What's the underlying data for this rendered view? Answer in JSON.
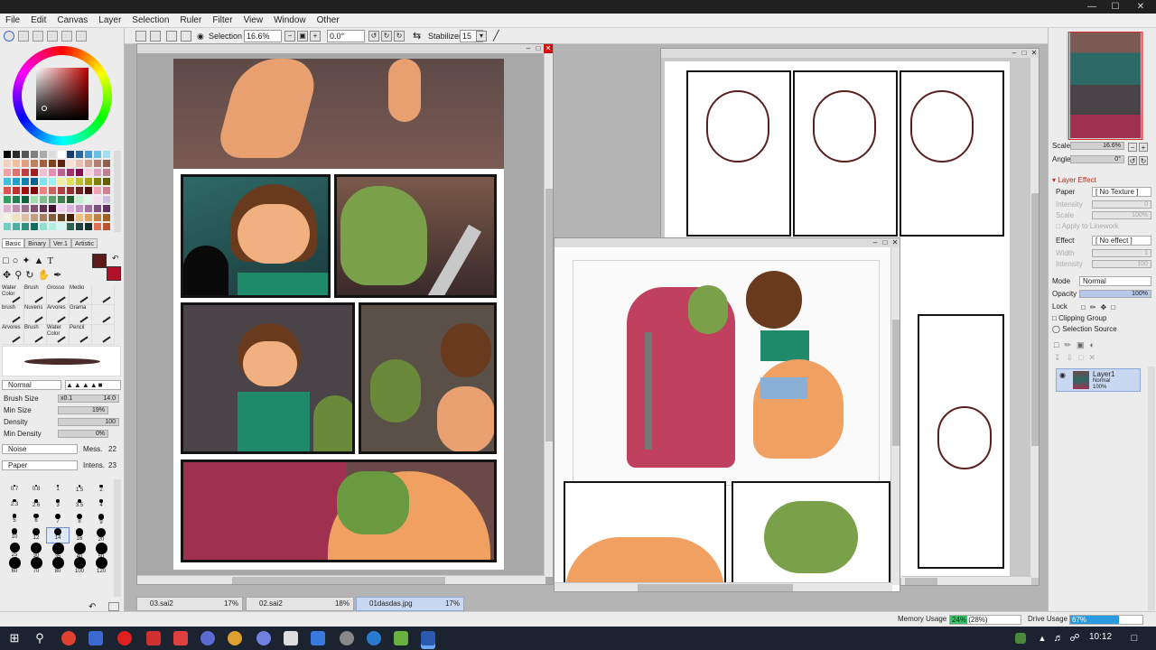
{
  "menu": [
    "File",
    "Edit",
    "Canvas",
    "Layer",
    "Selection",
    "Ruler",
    "Filter",
    "View",
    "Window",
    "Other"
  ],
  "toolbar": {
    "selection_label": "Selection",
    "zoom_value": "16.6%",
    "rotation_value": "0.0°",
    "stabilizer_label": "Stabilizer",
    "stabilizer_value": "15"
  },
  "color_tabs": [
    "Basic",
    "Binary",
    "Ver.1",
    "Artistic"
  ],
  "brushes": [
    [
      "Water Color",
      "Brush",
      "Grosso",
      "Medio",
      ""
    ],
    [
      "brush",
      "Nuvens",
      "Arvores",
      "Grama",
      ""
    ],
    [
      "Arvores",
      "Brush",
      "Water Color",
      "Pencil",
      ""
    ]
  ],
  "brush_settings": {
    "blend_mode": "Normal",
    "brush_size_label": "Brush Size",
    "brush_size_mult": "x0.1",
    "brush_size_value": "14.0",
    "min_size_label": "Min Size",
    "min_size_value": "19%",
    "density_label": "Density",
    "density_value": "100",
    "min_density_label": "Min Density",
    "min_density_value": "0%",
    "noise_label": "Noise",
    "noise_mess_label": "Mess.",
    "noise_mess_value": "22",
    "paper_label": "Paper",
    "paper_intens_label": "Intens.",
    "paper_intens_value": "23"
  },
  "dot_sizes": [
    "0.7",
    "0.8",
    "1",
    "1.5",
    "2",
    "2.3",
    "2.6",
    "3",
    "3.5",
    "4",
    "5",
    "6",
    "7",
    "8",
    "9",
    "10",
    "12",
    "14",
    "16",
    "20",
    "25",
    "30",
    "35",
    "40",
    "50",
    "60",
    "70",
    "80",
    "100",
    "120"
  ],
  "navigator": {
    "scale_label": "Scale",
    "scale_value": "16.6%",
    "angle_label": "Angle",
    "angle_value": "0°"
  },
  "layer_effect": {
    "header": "Layer Effect",
    "paper_label": "Paper",
    "paper_value": "[ No Texture ]",
    "intensity_label": "Intensity",
    "intensity_value": "0",
    "scale_label": "Scale",
    "scale_value": "100%",
    "apply_label": "Apply to Linework",
    "effect_label": "Effect",
    "effect_value": "[ No effect ]",
    "width_label": "Width",
    "width_value": "1",
    "effect_intensity_label": "Intensity",
    "effect_intensity_value": "100"
  },
  "layer_props": {
    "mode_label": "Mode",
    "mode_value": "Normal",
    "opacity_label": "Opacity",
    "opacity_value": "100%",
    "lock_label": "Lock",
    "clipping_label": "Clipping Group",
    "selection_source_label": "Selection Source"
  },
  "layers": [
    {
      "name": "Layer1",
      "mode": "Normal",
      "opacity": "100%"
    }
  ],
  "doc_tabs": [
    {
      "name": "03.sai2",
      "zoom": "17%"
    },
    {
      "name": "02.sai2",
      "zoom": "18%"
    },
    {
      "name": "01dasdas.jpg",
      "zoom": "17%"
    }
  ],
  "status": {
    "memory_label": "Memory Usage",
    "memory_value": "24% (28%)",
    "memory_fill": 0.24,
    "drive_label": "Drive Usage",
    "drive_value": "67%",
    "drive_fill": 0.67
  },
  "taskbar": {
    "time": "10:12"
  },
  "colors": {
    "primary": "#5a1a1a",
    "secondary": "#b0102a",
    "selection_accent": "#c8d8f0"
  }
}
